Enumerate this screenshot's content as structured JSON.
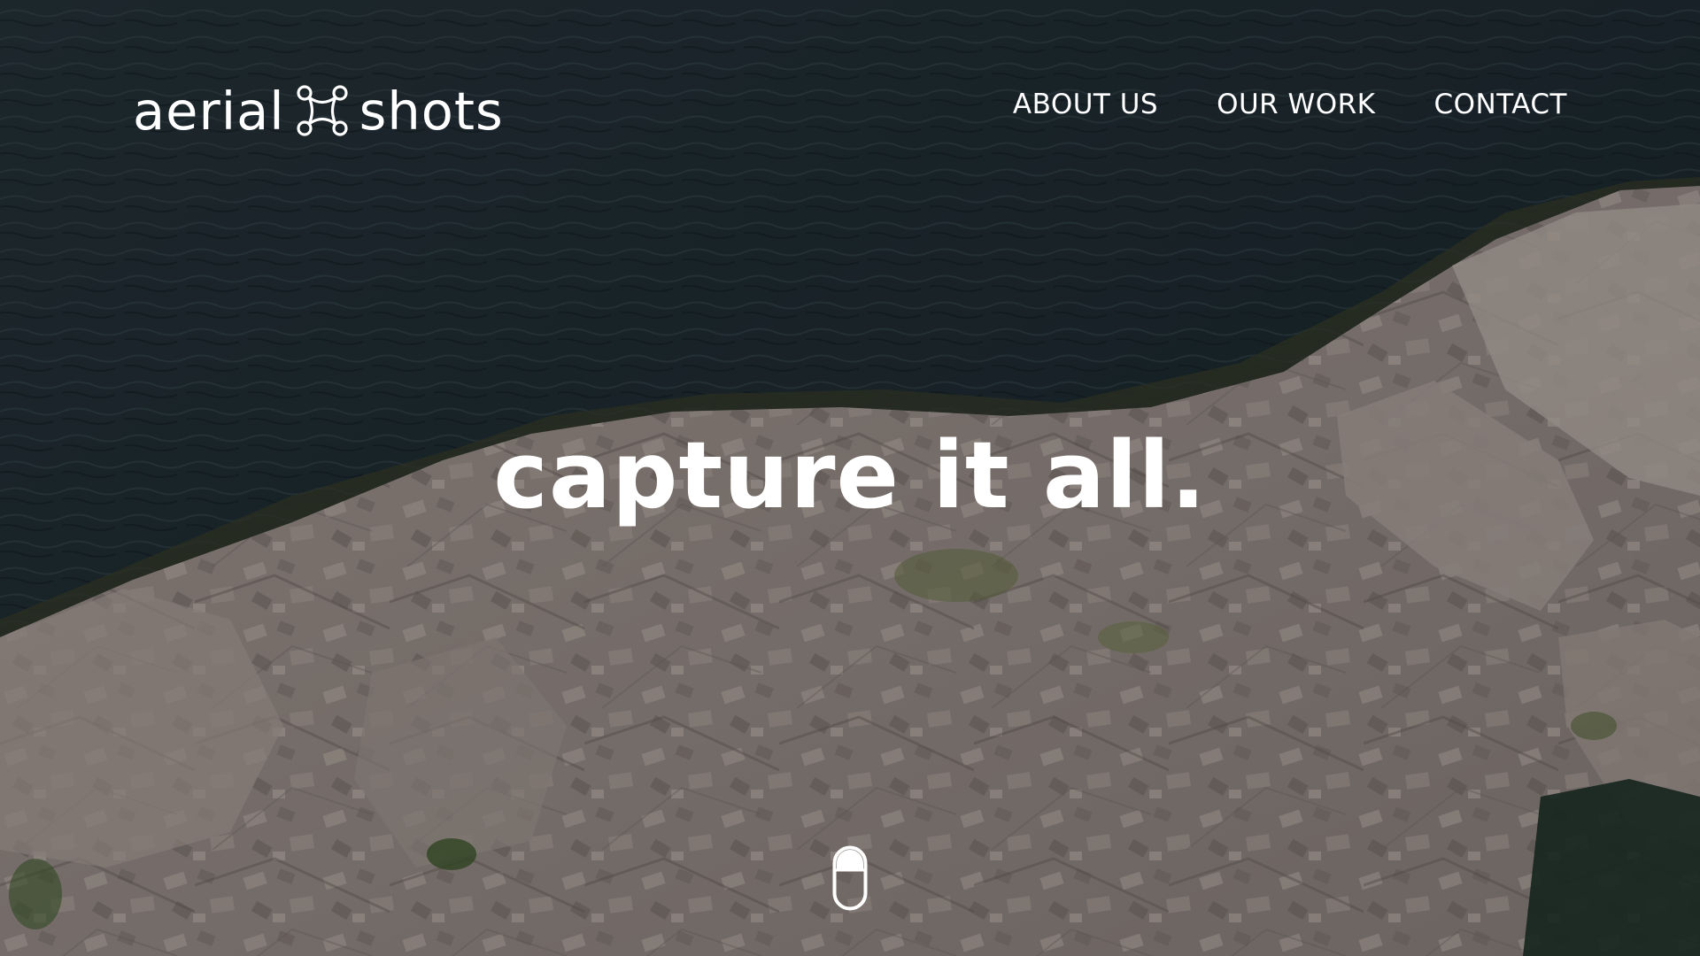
{
  "brand": {
    "logo_left": "aerial",
    "logo_right": "shots",
    "logo_icon": "drone-icon"
  },
  "nav": {
    "items": [
      {
        "label": "ABOUT US"
      },
      {
        "label": "OUR WORK"
      },
      {
        "label": "CONTACT"
      }
    ]
  },
  "hero": {
    "headline": "capture it all.",
    "background": "aerial-coastline-photo",
    "scroll_icon": "mouse-scroll-icon"
  },
  "colors": {
    "text": "#ffffff",
    "water": "#1f3039",
    "rock": "#a59892"
  }
}
